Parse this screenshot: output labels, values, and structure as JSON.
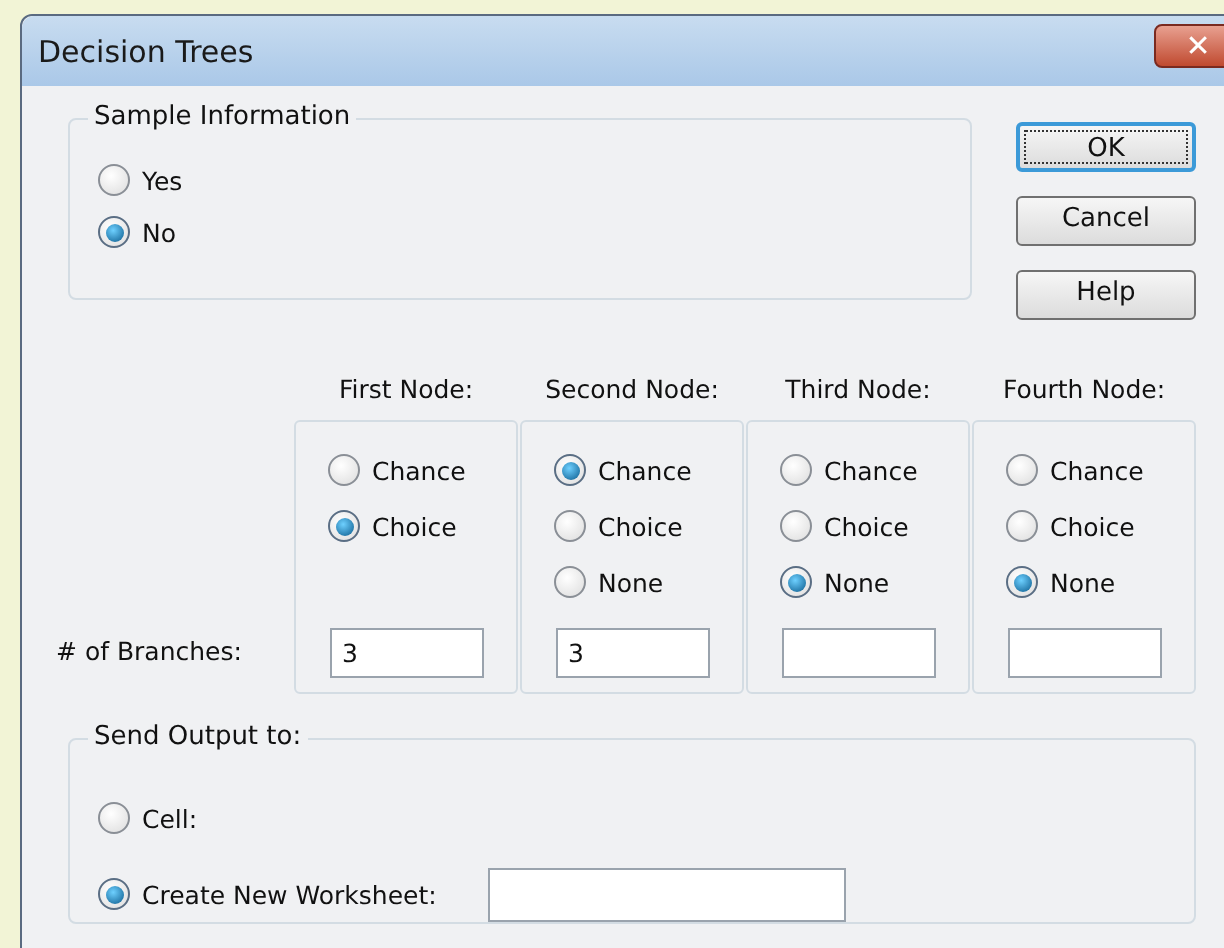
{
  "window": {
    "title": "Decision Trees",
    "close": "✕"
  },
  "sample_information": {
    "label": "Sample Information",
    "options": [
      {
        "label": "Yes",
        "selected": false
      },
      {
        "label": "No",
        "selected": true
      }
    ]
  },
  "buttons": [
    {
      "label": "OK",
      "default": true
    },
    {
      "label": "Cancel",
      "default": false
    },
    {
      "label": "Help",
      "default": false
    }
  ],
  "nodes": {
    "branches_label": "# of Branches:",
    "columns": [
      {
        "header": "First Node:",
        "options": [
          {
            "label": "Chance",
            "selected": false
          },
          {
            "label": "Choice",
            "selected": true
          }
        ],
        "branches": "3"
      },
      {
        "header": "Second Node:",
        "options": [
          {
            "label": "Chance",
            "selected": true
          },
          {
            "label": "Choice",
            "selected": false
          },
          {
            "label": "None",
            "selected": false
          }
        ],
        "branches": "3"
      },
      {
        "header": "Third Node:",
        "options": [
          {
            "label": "Chance",
            "selected": false
          },
          {
            "label": "Choice",
            "selected": false
          },
          {
            "label": "None",
            "selected": true
          }
        ]
      },
      {
        "header": "Fourth Node:",
        "options": [
          {
            "label": "Chance",
            "selected": false
          },
          {
            "label": "Choice",
            "selected": false
          },
          {
            "label": "None",
            "selected": true
          }
        ]
      }
    ]
  },
  "output": {
    "label": "Send Output to:",
    "options": [
      {
        "label": "Cell:",
        "selected": false,
        "kind": "plain"
      },
      {
        "label": "Create New Worksheet:",
        "selected": true,
        "kind": "field"
      }
    ]
  }
}
